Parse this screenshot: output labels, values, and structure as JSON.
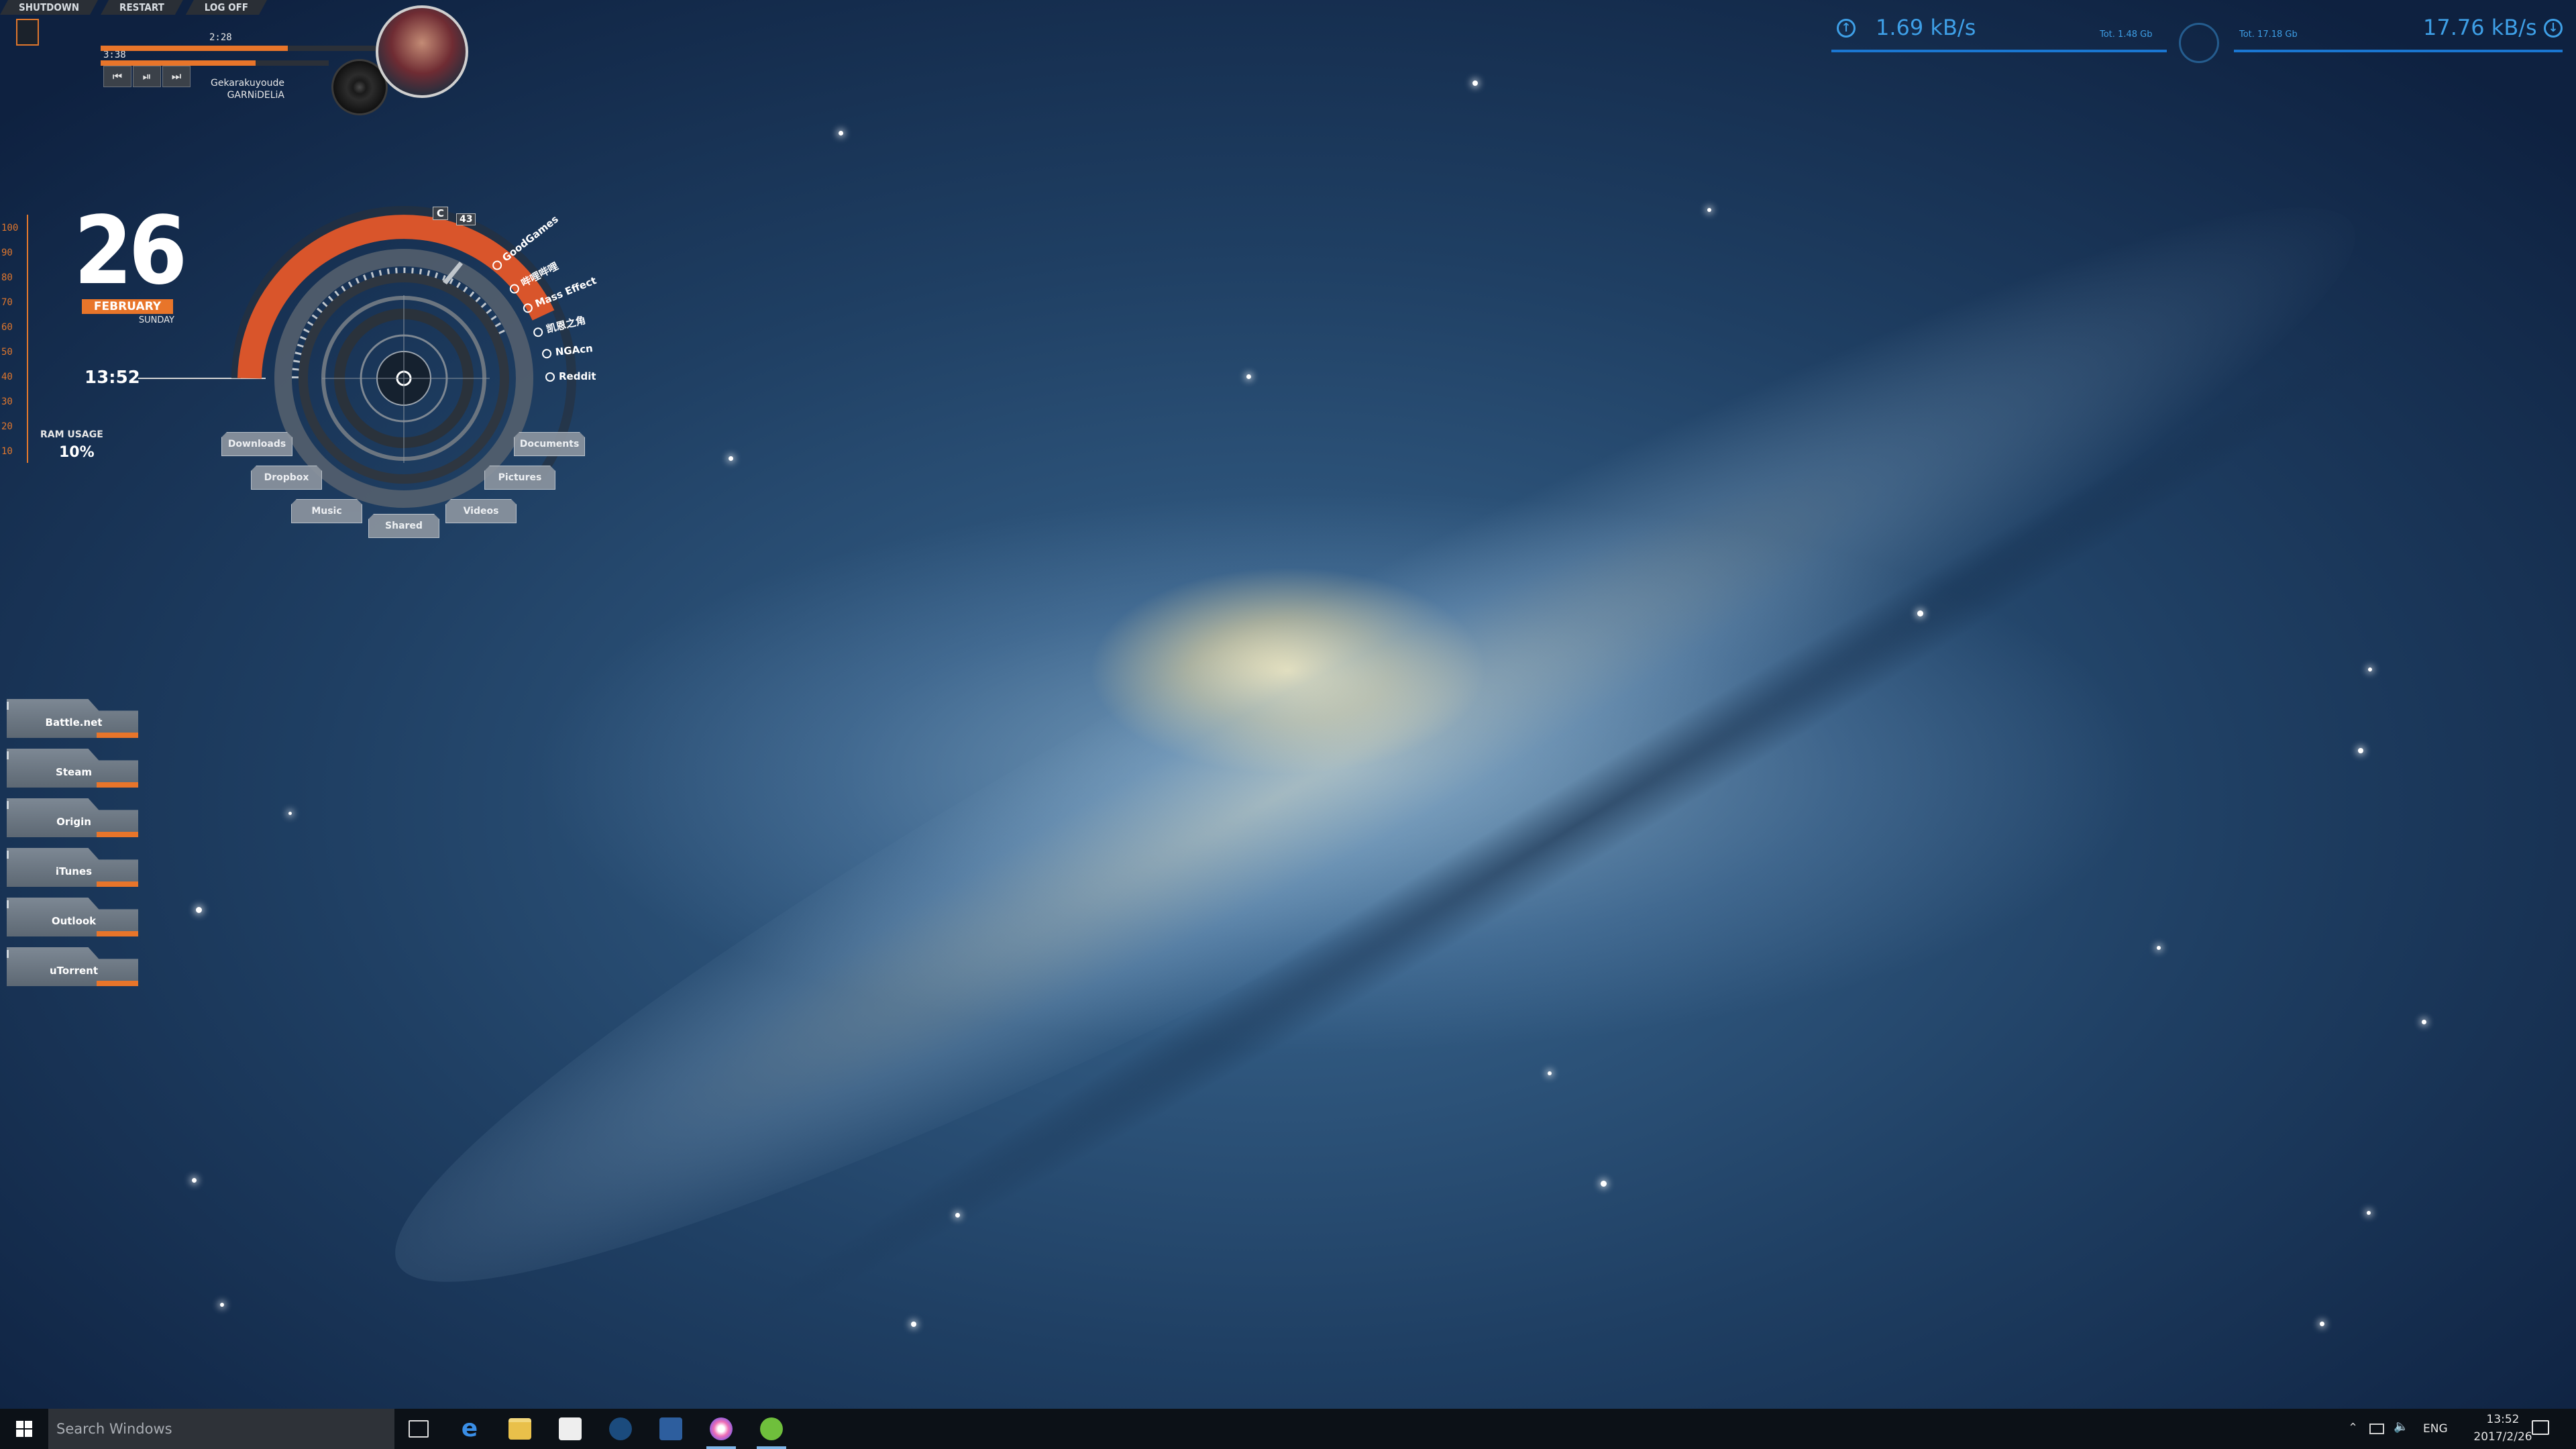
{
  "power": {
    "shutdown": "SHUTDOWN",
    "restart": "RESTART",
    "logoff": "LOG OFF"
  },
  "player": {
    "elapsed": "2:28",
    "duration": "3:38",
    "progress": 0.68,
    "title": "Gekarakuyoude",
    "artist": "GARNiDELiA",
    "prev": "⏮",
    "play": "⏯",
    "next": "⏭"
  },
  "scale": [
    "100",
    "90",
    "80",
    "70",
    "60",
    "50",
    "40",
    "30",
    "20",
    "10"
  ],
  "date": {
    "day": "26",
    "month": "FEBRUARY",
    "weekday": "SUNDAY"
  },
  "clock": "13:52",
  "ram": {
    "label": "RAM USAGE",
    "value": "10%"
  },
  "hud": {
    "drive_c": "C",
    "counter": "43",
    "links": [
      "GoodGames",
      "哔哩哔哩",
      "Mass Effect",
      "凯恩之角",
      "NGAcn",
      "Reddit"
    ],
    "folders": [
      "Downloads",
      "Documents",
      "Dropbox",
      "Pictures",
      "Music",
      "Videos",
      "Shared"
    ]
  },
  "launchers": [
    "Battle.net",
    "Steam",
    "Origin",
    "iTunes",
    "Outlook",
    "uTorrent"
  ],
  "network": {
    "upload_speed": "1.69 kB/s",
    "upload_total": "Tot. 1.48 Gb",
    "download_total": "Tot. 17.18 Gb",
    "download_speed": "17.76 kB/s"
  },
  "taskbar": {
    "search_placeholder": "Search Windows",
    "apps": [
      "task-view",
      "edge",
      "file-explorer",
      "store",
      "steam",
      "visual-studio",
      "itunes",
      "utorrent"
    ],
    "language": "ENG",
    "time": "13:52",
    "date": "2017/2/26"
  },
  "colors": {
    "accent": "#e8752a",
    "network": "#3e9fe6",
    "taskbar": "#0c1117"
  }
}
